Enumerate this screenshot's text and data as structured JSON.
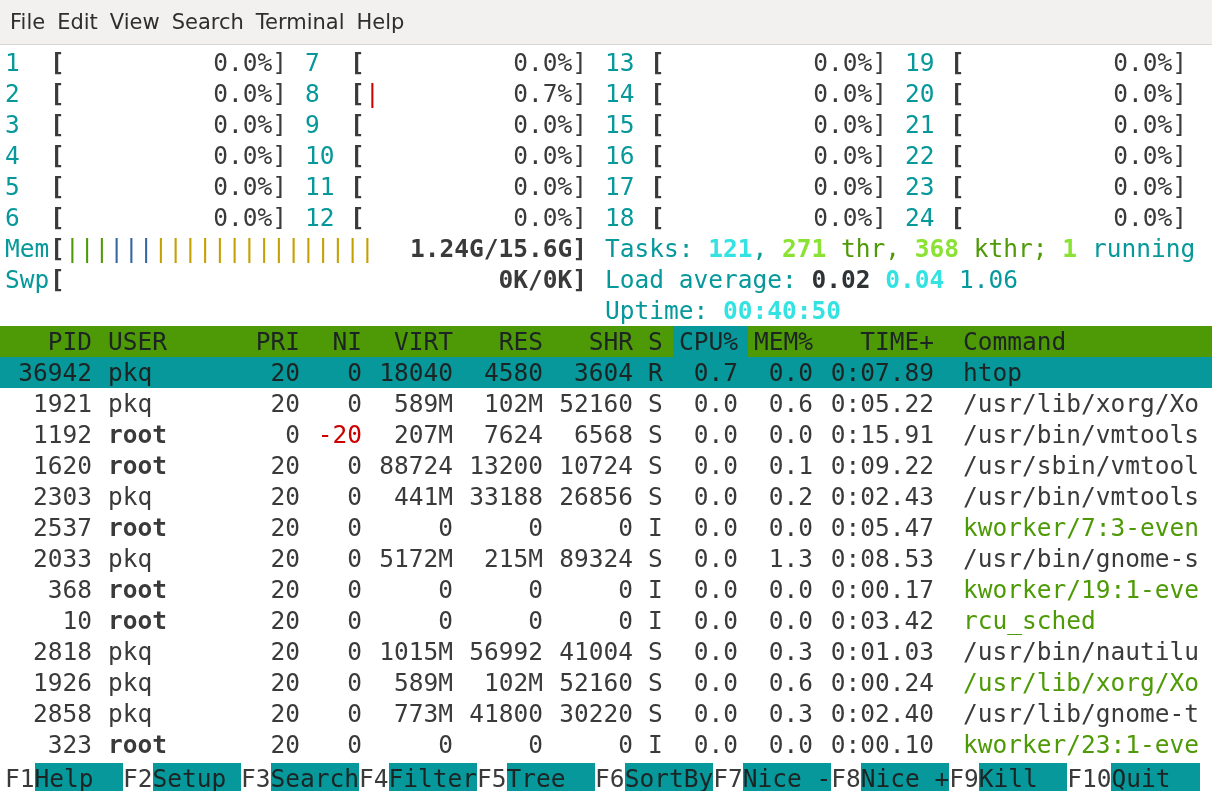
{
  "menu": [
    "File",
    "Edit",
    "View",
    "Search",
    "Terminal",
    "Help"
  ],
  "cpus": [
    {
      "id": "1",
      "open": "[",
      "value": "0.0%]"
    },
    {
      "id": "2",
      "open": "[",
      "value": "0.0%]"
    },
    {
      "id": "3",
      "open": "[",
      "value": "0.0%]"
    },
    {
      "id": "4",
      "open": "[",
      "value": "0.0%]"
    },
    {
      "id": "5",
      "open": "[",
      "value": "0.0%]"
    },
    {
      "id": "6",
      "open": "[",
      "value": "0.0%]"
    },
    {
      "id": "7",
      "open": "[",
      "value": "0.0%]"
    },
    {
      "id": "8",
      "open": "[",
      "bar": "|",
      "value": "0.7%]"
    },
    {
      "id": "9",
      "open": "[",
      "value": "0.0%]"
    },
    {
      "id": "10",
      "open": "[",
      "value": "0.0%]"
    },
    {
      "id": "11",
      "open": "[",
      "value": "0.0%]"
    },
    {
      "id": "12",
      "open": "[",
      "value": "0.0%]"
    },
    {
      "id": "13",
      "open": "[",
      "value": "0.0%]"
    },
    {
      "id": "14",
      "open": "[",
      "value": "0.0%]"
    },
    {
      "id": "15",
      "open": "[",
      "value": "0.0%]"
    },
    {
      "id": "16",
      "open": "[",
      "value": "0.0%]"
    },
    {
      "id": "17",
      "open": "[",
      "value": "0.0%]"
    },
    {
      "id": "18",
      "open": "[",
      "value": "0.0%]"
    },
    {
      "id": "19",
      "open": "[",
      "value": "0.0%]"
    },
    {
      "id": "20",
      "open": "[",
      "value": "0.0%]"
    },
    {
      "id": "21",
      "open": "[",
      "value": "0.0%]"
    },
    {
      "id": "22",
      "open": "[",
      "value": "0.0%]"
    },
    {
      "id": "23",
      "open": "[",
      "value": "0.0%]"
    },
    {
      "id": "24",
      "open": "[",
      "value": "0.0%]"
    }
  ],
  "memory": [
    {
      "label": "Mem",
      "open": "[",
      "segments": [
        {
          "text": "|||",
          "color": "#4e9a06"
        },
        {
          "text": "|||",
          "color": "#3465a4"
        },
        {
          "text": "|||||||||||||||",
          "color": "#c4a000"
        }
      ],
      "value": "1.24G/15.6G]"
    },
    {
      "label": "Swp",
      "open": "[",
      "value": "0K/0K]"
    }
  ],
  "summary": [
    [
      {
        "text": "Tasks: ",
        "kind": "label"
      },
      {
        "text": "121",
        "kind": "cyan"
      },
      {
        "text": ", ",
        "kind": "label"
      },
      {
        "text": "271",
        "kind": "green"
      },
      {
        "text": " thr, ",
        "kind": "thread"
      },
      {
        "text": "368",
        "kind": "green"
      },
      {
        "text": " kthr; ",
        "kind": "thread"
      },
      {
        "text": "1",
        "kind": "green"
      },
      {
        "text": " running",
        "kind": "label"
      }
    ],
    [
      {
        "text": "Load average: ",
        "kind": "label"
      },
      {
        "text": "0.02 ",
        "kind": "bold"
      },
      {
        "text": "0.04 ",
        "kind": "cyan"
      },
      {
        "text": "1.06",
        "kind": "label"
      }
    ],
    [
      {
        "text": "Uptime: ",
        "kind": "label"
      },
      {
        "text": "00:40:50",
        "kind": "cyan"
      }
    ]
  ],
  "columns": [
    {
      "label": "PID",
      "selected": false
    },
    {
      "label": "USER",
      "selected": false
    },
    {
      "label": "PRI",
      "selected": false
    },
    {
      "label": "NI",
      "selected": false
    },
    {
      "label": "VIRT",
      "selected": false
    },
    {
      "label": "RES",
      "selected": false
    },
    {
      "label": "SHR",
      "selected": false
    },
    {
      "label": "S",
      "selected": false
    },
    {
      "label": "CPU%",
      "selected": true
    },
    {
      "label": "MEM%",
      "selected": false
    },
    {
      "label": "TIME+",
      "selected": false
    },
    {
      "label": "Command",
      "selected": false
    }
  ],
  "processes": [
    {
      "cells": [
        "36942",
        "pkq",
        "20",
        "0",
        "18040",
        "4580",
        "3604",
        "R",
        "0.7",
        "0.0",
        "0:07.89",
        "htop"
      ],
      "selected": true,
      "bold_user": false,
      "ni_negative": false,
      "kind": "process"
    },
    {
      "cells": [
        "1921",
        "pkq",
        "20",
        "0",
        "589M",
        "102M",
        "52160",
        "S",
        "0.0",
        "0.6",
        "0:05.22",
        "/usr/lib/xorg/Xo"
      ],
      "selected": false,
      "bold_user": false,
      "ni_negative": false,
      "kind": "process"
    },
    {
      "cells": [
        "1192",
        "root",
        "0",
        "-20",
        "207M",
        "7624",
        "6568",
        "S",
        "0.0",
        "0.0",
        "0:15.91",
        "/usr/bin/vmtools"
      ],
      "selected": false,
      "bold_user": true,
      "ni_negative": true,
      "kind": "process"
    },
    {
      "cells": [
        "1620",
        "root",
        "20",
        "0",
        "88724",
        "13200",
        "10724",
        "S",
        "0.0",
        "0.1",
        "0:09.22",
        "/usr/sbin/vmtool"
      ],
      "selected": false,
      "bold_user": true,
      "ni_negative": false,
      "kind": "process"
    },
    {
      "cells": [
        "2303",
        "pkq",
        "20",
        "0",
        "441M",
        "33188",
        "26856",
        "S",
        "0.0",
        "0.2",
        "0:02.43",
        "/usr/bin/vmtools"
      ],
      "selected": false,
      "bold_user": false,
      "ni_negative": false,
      "kind": "process"
    },
    {
      "cells": [
        "2537",
        "root",
        "20",
        "0",
        "0",
        "0",
        "0",
        "I",
        "0.0",
        "0.0",
        "0:05.47",
        "kworker/7:3-even"
      ],
      "selected": false,
      "bold_user": true,
      "ni_negative": false,
      "kind": "thread"
    },
    {
      "cells": [
        "2033",
        "pkq",
        "20",
        "0",
        "5172M",
        "215M",
        "89324",
        "S",
        "0.0",
        "1.3",
        "0:08.53",
        "/usr/bin/gnome-s"
      ],
      "selected": false,
      "bold_user": false,
      "ni_negative": false,
      "kind": "process"
    },
    {
      "cells": [
        "368",
        "root",
        "20",
        "0",
        "0",
        "0",
        "0",
        "I",
        "0.0",
        "0.0",
        "0:00.17",
        "kworker/19:1-eve"
      ],
      "selected": false,
      "bold_user": true,
      "ni_negative": false,
      "kind": "thread"
    },
    {
      "cells": [
        "10",
        "root",
        "20",
        "0",
        "0",
        "0",
        "0",
        "I",
        "0.0",
        "0.0",
        "0:03.42",
        "rcu_sched"
      ],
      "selected": false,
      "bold_user": true,
      "ni_negative": false,
      "kind": "thread"
    },
    {
      "cells": [
        "2818",
        "pkq",
        "20",
        "0",
        "1015M",
        "56992",
        "41004",
        "S",
        "0.0",
        "0.3",
        "0:01.03",
        "/usr/bin/nautilu"
      ],
      "selected": false,
      "bold_user": false,
      "ni_negative": false,
      "kind": "process"
    },
    {
      "cells": [
        "1926",
        "pkq",
        "20",
        "0",
        "589M",
        "102M",
        "52160",
        "S",
        "0.0",
        "0.6",
        "0:00.24",
        "/usr/lib/xorg/Xo"
      ],
      "selected": false,
      "bold_user": false,
      "ni_negative": false,
      "kind": "thread"
    },
    {
      "cells": [
        "2858",
        "pkq",
        "20",
        "0",
        "773M",
        "41800",
        "30220",
        "S",
        "0.0",
        "0.3",
        "0:02.40",
        "/usr/lib/gnome-t"
      ],
      "selected": false,
      "bold_user": false,
      "ni_negative": false,
      "kind": "process"
    },
    {
      "cells": [
        "323",
        "root",
        "20",
        "0",
        "0",
        "0",
        "0",
        "I",
        "0.0",
        "0.0",
        "0:00.10",
        "kworker/23:1-eve"
      ],
      "selected": false,
      "bold_user": true,
      "ni_negative": false,
      "kind": "thread"
    }
  ],
  "function_keys": [
    {
      "key": "F1",
      "label": "Help"
    },
    {
      "key": "F2",
      "label": "Setup"
    },
    {
      "key": "F3",
      "label": "Search"
    },
    {
      "key": "F4",
      "label": "Filter"
    },
    {
      "key": "F5",
      "label": "Tree"
    },
    {
      "key": "F6",
      "label": "SortBy"
    },
    {
      "key": "F7",
      "label": "Nice -"
    },
    {
      "key": "F8",
      "label": "Nice +"
    },
    {
      "key": "F9",
      "label": "Kill"
    },
    {
      "key": "F10",
      "label": "Quit"
    }
  ]
}
